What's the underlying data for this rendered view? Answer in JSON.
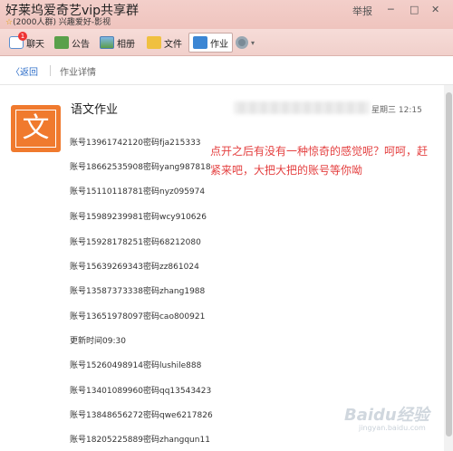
{
  "window": {
    "title": "好莱坞爱奇艺vip共享群",
    "subtitle_star": "☆",
    "subtitle": "(2000人群) 兴趣爱好-影视",
    "report": "举报"
  },
  "toolbar": {
    "items": [
      {
        "label": "聊天",
        "badge": "1",
        "icon": "chat-icon"
      },
      {
        "label": "公告",
        "icon": "notice-icon"
      },
      {
        "label": "相册",
        "icon": "album-icon"
      },
      {
        "label": "文件",
        "icon": "file-icon"
      },
      {
        "label": "作业",
        "icon": "homework-icon",
        "active": true
      }
    ],
    "settings_icon": "gear-icon"
  },
  "nav": {
    "back": "返回",
    "title": "作业详情"
  },
  "homework": {
    "avatar_char": "文",
    "title": "语文作业",
    "time": "星期三 12:15",
    "lines": [
      "账号13961742120密码fja215333",
      "账号18662535908密码yang987818",
      "账号15110118781密码nyz095974",
      "账号15989239981密码wcy910626",
      "账号15928178251密码68212080",
      "账号15639269343密码zz861024",
      "账号13587373338密码zhang1988",
      "账号13651978097密码cao800921",
      "更新时间09:30",
      "账号15260498914密码lushile888",
      "账号13401089960密码qq13543423",
      "账号13848656272密码qwe6217826",
      "账号18205225889密码zhangqun11"
    ]
  },
  "annotation": "点开之后有没有一种惊奇的感觉呢？呵呵，赶紧来吧，大把大把的账号等你呦",
  "watermark": {
    "text": "Baidu经验",
    "sub": "jingyan.baidu.com"
  },
  "colors": {
    "titlebar": "#efc4be",
    "accent_link": "#2f6fc9",
    "annotation": "#e43f3f",
    "avatar": "#f07a2e"
  }
}
